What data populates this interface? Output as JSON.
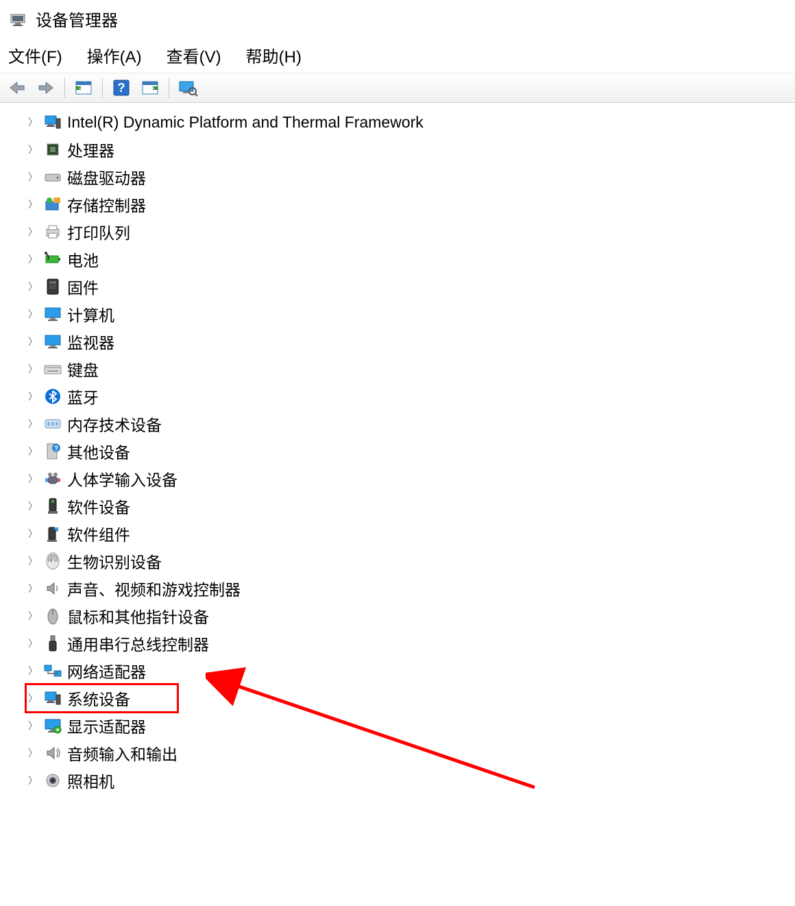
{
  "window": {
    "title": "设备管理器"
  },
  "menu": {
    "file": "文件(F)",
    "action": "操作(A)",
    "view": "查看(V)",
    "help": "帮助(H)"
  },
  "tree": {
    "items": [
      {
        "label": "Intel(R) Dynamic Platform and Thermal Framework",
        "icon": "computer"
      },
      {
        "label": "处理器",
        "icon": "cpu"
      },
      {
        "label": "磁盘驱动器",
        "icon": "disk"
      },
      {
        "label": "存储控制器",
        "icon": "storage"
      },
      {
        "label": "打印队列",
        "icon": "printer"
      },
      {
        "label": "电池",
        "icon": "battery"
      },
      {
        "label": "固件",
        "icon": "firmware"
      },
      {
        "label": "计算机",
        "icon": "monitor"
      },
      {
        "label": "监视器",
        "icon": "monitor"
      },
      {
        "label": "键盘",
        "icon": "keyboard"
      },
      {
        "label": "蓝牙",
        "icon": "bluetooth"
      },
      {
        "label": "内存技术设备",
        "icon": "memory"
      },
      {
        "label": "其他设备",
        "icon": "other"
      },
      {
        "label": "人体学输入设备",
        "icon": "hid"
      },
      {
        "label": "软件设备",
        "icon": "software"
      },
      {
        "label": "软件组件",
        "icon": "component"
      },
      {
        "label": "生物识别设备",
        "icon": "biometric"
      },
      {
        "label": "声音、视频和游戏控制器",
        "icon": "sound"
      },
      {
        "label": "鼠标和其他指针设备",
        "icon": "mouse"
      },
      {
        "label": "通用串行总线控制器",
        "icon": "usb"
      },
      {
        "label": "网络适配器",
        "icon": "network"
      },
      {
        "label": "系统设备",
        "icon": "computer",
        "highlight": true
      },
      {
        "label": "显示适配器",
        "icon": "display"
      },
      {
        "label": "音频输入和输出",
        "icon": "audio"
      },
      {
        "label": "照相机",
        "icon": "camera"
      }
    ]
  }
}
